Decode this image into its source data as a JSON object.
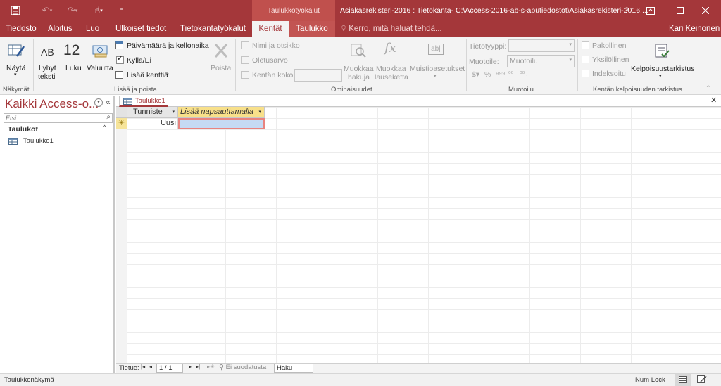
{
  "window": {
    "doc_title": "Asiakasrekisteri-2016 : Tietokanta- C:\\Access-2016-ab-s-aputiedostot\\Asiakasrekisteri-2016....",
    "context_tools": "Taulukkotyökalut",
    "help": "?"
  },
  "tabs": [
    "Tiedosto",
    "Aloitus",
    "Luo",
    "Ulkoiset tiedot",
    "Tietokantatyökalut",
    "Kentät",
    "Taulukko"
  ],
  "tell_me": "Kerro, mitä haluat tehdä...",
  "user": "Kari Keinonen",
  "ribbon": {
    "nakymat": {
      "group": "Näkymät",
      "view": "Näytä"
    },
    "lisaa": {
      "group": "Lisää ja poista",
      "short_text_1": "Lyhyt",
      "short_text_2": "teksti",
      "number_label": "Luku",
      "number_icon": "12",
      "currency": "Valuutta",
      "date_time": "Päivämäärä ja kellonaika",
      "yes_no": "Kyllä/Ei",
      "more_fields": "Lisää kenttiä",
      "delete": "Poista",
      "ab_icon": "AB"
    },
    "ominaisuudet": {
      "group": "Ominaisuudet",
      "name_caption": "Nimi ja otsikko",
      "default_value": "Oletusarvo",
      "field_size": "Kentän koko",
      "modify_lookups_1": "Muokkaa",
      "modify_lookups_2": "hakuja",
      "modify_expr_1": "Muokkaa",
      "modify_expr_2": "lauseketta",
      "memo_settings": "Muistioasetukset"
    },
    "muotoilu": {
      "group": "Muotoilu",
      "data_type": "Tietotyyppi:",
      "format": "Muotoile:",
      "format_value": "Muotoilu"
    },
    "kelpoisuus": {
      "group": "Kentän kelpoisuuden tarkistus",
      "required": "Pakollinen",
      "unique": "Yksilöllinen",
      "indexed": "Indeksoitu",
      "validation": "Kelpoisuustarkistus"
    }
  },
  "nav_pane": {
    "title": "Kaikki Access-o...",
    "search_placeholder": "Etsi...",
    "section": "Taulukot",
    "items": [
      "Taulukko1"
    ]
  },
  "document": {
    "tab": "Taulukko1",
    "columns": [
      "Tunniste",
      "Lisää napsauttamalla"
    ],
    "new_row_value": "Uusi"
  },
  "record_nav": {
    "label": "Tietue:",
    "position": "1 / 1",
    "filter": "Ei suodatusta",
    "search": "Haku"
  },
  "status": {
    "view": "Taulukkonäkymä",
    "num_lock": "Num Lock"
  },
  "colors": {
    "accent": "#a4373a",
    "selected_cell": "#c5daf3",
    "new_field_header": "#f8e08a"
  }
}
